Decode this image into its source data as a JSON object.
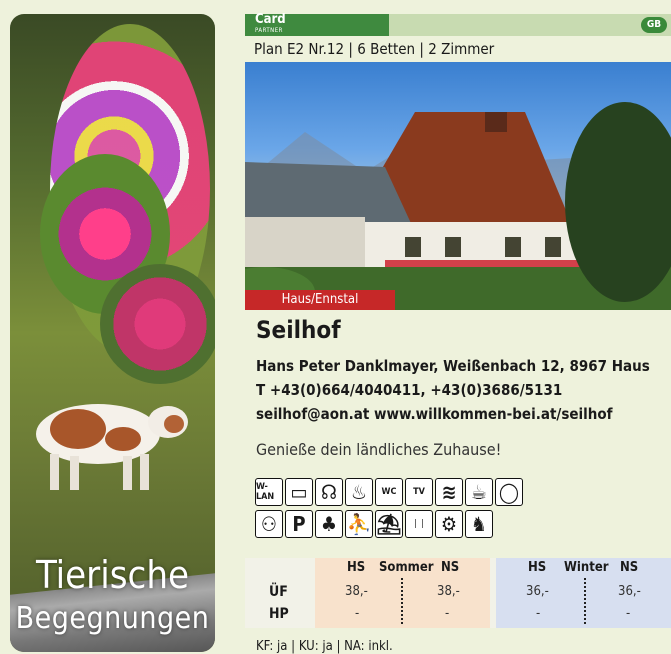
{
  "left_panel": {
    "caption_line1": "Tierische",
    "caption_line2": "Begegnungen"
  },
  "header": {
    "logo_top": "Card",
    "logo_bottom": "PARTNER",
    "lang_badge": "GB"
  },
  "plan_info": "Plan E2 Nr.12 | 6 Betten | 2 Zimmer",
  "location_tag": "Haus/Ennstal",
  "listing": {
    "name": "Seilhof",
    "address": "Hans Peter Danklmayer, Weißenbach 12, 8967 Haus",
    "phone": "T +43(0)664/4040411, +43(0)3686/5131",
    "web": "seilhof@aon.at www.willkommen-bei.at/seilhof",
    "slogan": "Genieße dein ländliches Zuhause!"
  },
  "amenity_icons_row1": [
    {
      "name": "wlan-icon",
      "text": "W-LAN"
    },
    {
      "name": "tv-icon",
      "text": "▭"
    },
    {
      "name": "hairdryer-icon",
      "text": "☊"
    },
    {
      "name": "sauna-icon",
      "text": "♨"
    },
    {
      "name": "wc-icon",
      "text": "WC"
    },
    {
      "name": "tv-cable-icon",
      "text": "TV"
    },
    {
      "name": "terrace-icon",
      "text": "≋"
    },
    {
      "name": "kitchen-icon",
      "text": "☕"
    },
    {
      "name": "egg-icon",
      "text": "◯"
    }
  ],
  "amenity_icons_row2": [
    {
      "name": "family-icon",
      "text": "⚇"
    },
    {
      "name": "parking-icon",
      "text": "P"
    },
    {
      "name": "garden-icon",
      "text": "♣"
    },
    {
      "name": "playground-icon",
      "text": "⛹"
    },
    {
      "name": "lounger-icon",
      "text": "⛱"
    },
    {
      "name": "ski-icon",
      "text": "❘❘"
    },
    {
      "name": "bike-garage-icon",
      "text": "⚙"
    },
    {
      "name": "farm-animals-icon",
      "text": "♞"
    }
  ],
  "price_table": {
    "row_labels": [
      "ÜF",
      "HP"
    ],
    "summer": {
      "hs_label": "HS",
      "season_label": "Sommer",
      "ns_label": "NS",
      "uef_hs": "38,-",
      "uef_ns": "38,-",
      "hp_hs": "-",
      "hp_ns": "-"
    },
    "winter": {
      "hs_label": "HS",
      "season_label": "Winter",
      "ns_label": "NS",
      "uef_hs": "36,-",
      "uef_ns": "36,-",
      "hp_hs": "-",
      "hp_ns": "-"
    }
  },
  "footer_note": "KF: ja | KU: ja | NA: inkl."
}
